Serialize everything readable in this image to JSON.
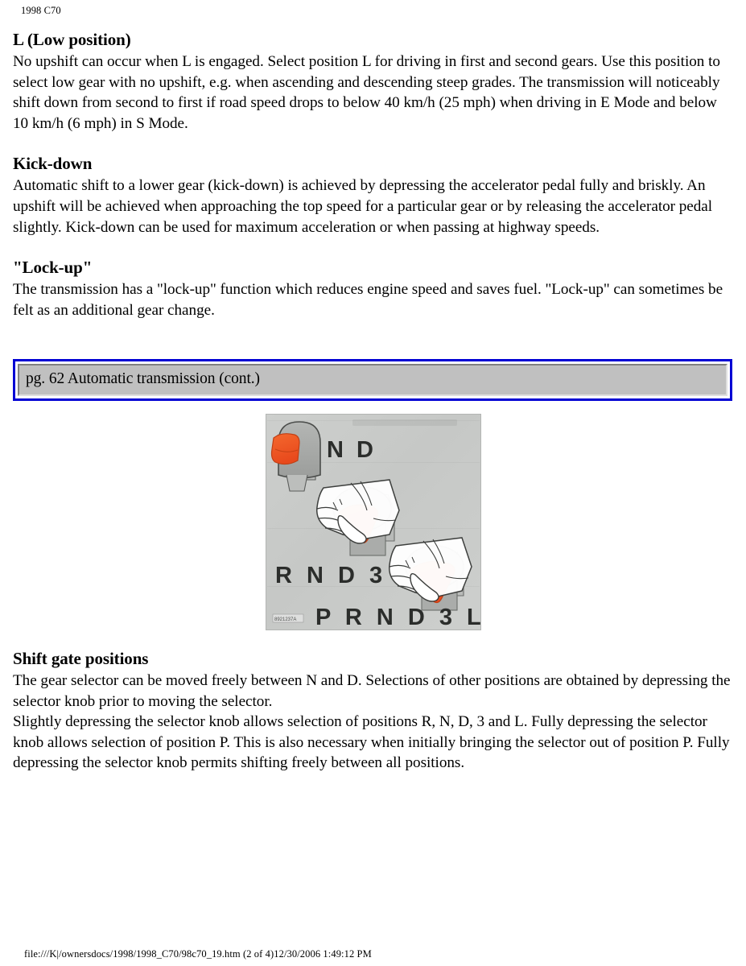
{
  "header": {
    "running_head": "1998 C70"
  },
  "sections": [
    {
      "heading": "L (Low position)",
      "paragraphs": [
        "No upshift can occur when L is engaged. Select position L for driving in first and second gears. Use this position to select low gear with no upshift, e.g. when ascending and descending steep grades. The transmission will noticeably shift down from second to first if road speed drops to below 40 km/h (25 mph) when driving in E Mode and below 10 km/h (6 mph) in S Mode."
      ]
    },
    {
      "heading": "Kick-down",
      "paragraphs": [
        "Automatic shift to a lower gear (kick-down) is achieved by depressing the accelerator pedal fully and briskly. An upshift will be achieved when approaching the top speed for a particular gear or by releasing the accelerator pedal slightly. Kick-down can be used for maximum acceleration or when passing at highway speeds."
      ]
    },
    {
      "heading": "\"Lock-up\"",
      "paragraphs": [
        "The transmission has a \"lock-up\" function which reduces engine speed and saves fuel. \"Lock-up\" can sometimes be felt as an additional gear change."
      ]
    }
  ],
  "nav_bar": {
    "label": "pg. 62 Automatic transmission (cont.)",
    "border_color": "#0000d4",
    "fill_color": "#c0c0c0"
  },
  "figure": {
    "alt": "Three gear selector knobs showing shift gate positions",
    "background_color": "#c9cbc9",
    "knob_color": "#a8aaa8",
    "button_color": "#f05a28",
    "gear_labels": [
      {
        "text": "N D",
        "row": 1
      },
      {
        "text": "R N D 3",
        "row": 2
      },
      {
        "text": "P R N D 3 L",
        "row": 3
      }
    ],
    "corner_code": "8921237A"
  },
  "lower_sections": [
    {
      "heading": "Shift gate positions",
      "paragraphs": [
        "The gear selector can be moved freely between N and D. Selections of other positions are obtained by depressing the selector knob prior to moving the selector.",
        "Slightly depressing the selector knob allows selection of positions R, N, D, 3 and L. Fully depressing the selector knob allows selection of position P. This is also necessary when initially bringing the selector out of position P. Fully depressing the selector knob permits shifting freely between all positions."
      ]
    }
  ],
  "footer": {
    "text": "file:///K|/ownersdocs/1998/1998_C70/98c70_19.htm (2 of 4)12/30/2006 1:49:12 PM"
  }
}
